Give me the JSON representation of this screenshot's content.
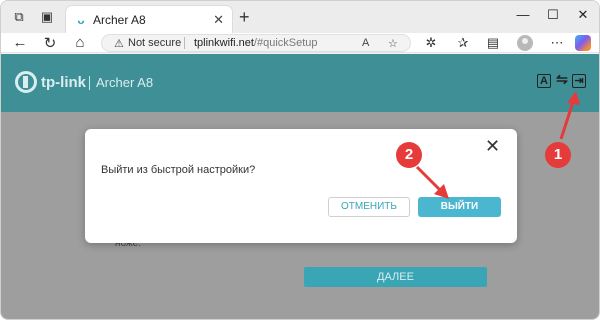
{
  "browser": {
    "tab": {
      "title": "Archer A8",
      "favicon": "tp-link-favicon",
      "close": "✕"
    },
    "new_tab": "+",
    "window": {
      "minimize": "—",
      "maximize": "☐",
      "close": "✕"
    },
    "toolbar": {
      "back": "←",
      "reload": "↻",
      "home": "⌂",
      "not_secure_label": "Not secure",
      "url_host": "tplinkwifi.net",
      "url_path": "/#quickSetup"
    }
  },
  "page": {
    "brand": "tp-link",
    "model": "Archer A8",
    "header_icons": [
      "language-icon",
      "switch-icon",
      "logout-icon"
    ],
    "header_icon_glyphs": {
      "language": "A",
      "switch": "⇋",
      "logout": "⇥"
    },
    "field_label": "ноже:",
    "next_button": "ДАЛЕЕ"
  },
  "dialog": {
    "question": "Выйти из быстрой настройки?",
    "cancel": "ОТМЕНИТЬ",
    "confirm": "ВЫЙТИ",
    "close": "✕"
  },
  "callouts": {
    "one": "1",
    "two": "2"
  },
  "colors": {
    "header": "#3f8f97",
    "accent": "#3aa5b4",
    "confirm": "#4ab6d0",
    "callout": "#e53b3b"
  }
}
